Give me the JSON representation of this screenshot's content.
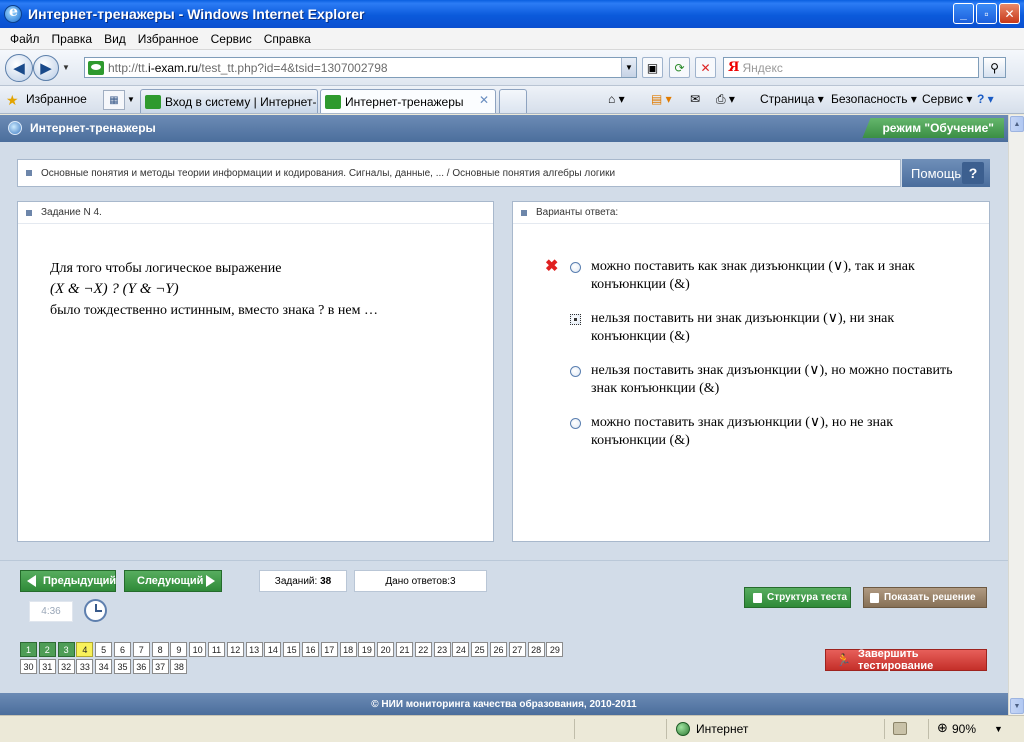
{
  "window": {
    "title": "Интернет-тренажеры - Windows Internet Explorer",
    "minimize": "_",
    "maximize": "▫",
    "close": "✕"
  },
  "menu": [
    "Файл",
    "Правка",
    "Вид",
    "Избранное",
    "Сервис",
    "Справка"
  ],
  "address": {
    "url_prefix": "http://tt.",
    "url_domain": "i-exam.ru",
    "url_rest": "/test_tt.php?id=4&tsid=1307002798"
  },
  "search": {
    "placeholder": "Яндекс",
    "logo": "Я"
  },
  "favorites": {
    "label": "Избранное",
    "tabs": [
      {
        "label": "Вход в систему | Интернет-...",
        "active": false
      },
      {
        "label": "Интернет-тренажеры",
        "active": true
      }
    ],
    "page_menu": "Страница ▾",
    "safety_menu": "Безопасность ▾",
    "service_menu": "Сервис ▾"
  },
  "site": {
    "title": "Интернет-тренажеры",
    "mode": "режим \"Обучение\"",
    "breadcrumb": "Основные понятия и методы теории информации и кодирования. Сигналы, данные, ... / Основные понятия алгебры логики",
    "help": "Помощь",
    "help_icon": "?"
  },
  "task": {
    "header": "Задание N 4.",
    "line1": "Для того чтобы логическое выражение",
    "formula": "(X & ¬X) ? (Y & ¬Y)",
    "line3": "было тождественно истинным, вместо знака  ?  в нем …"
  },
  "answers": {
    "header": "Варианты ответа:",
    "items": [
      {
        "text": "можно поставить как знак дизъюнкции (∨), так и знак конъюнкции (&)",
        "wrong": true,
        "selected": false
      },
      {
        "text": "нельзя поставить ни знак дизъюнкции (∨), ни знак конъюнкции (&)",
        "wrong": false,
        "selected": true
      },
      {
        "text": "нельзя поставить знак дизъюнкции (∨), но можно поставить знак конъюнкции (&)",
        "wrong": false,
        "selected": false
      },
      {
        "text": "можно поставить знак дизъюнкции (∨), но не знак конъюнкции (&)",
        "wrong": false,
        "selected": false
      }
    ]
  },
  "controls": {
    "prev": "Предыдущий",
    "next": "Следующий",
    "total_label": "Заданий:",
    "total_value": "38",
    "answered_label": "Дано ответов:",
    "answered_value": "3",
    "timer": "4:36",
    "structure": "Структура теста",
    "show_solution": "Показать решение",
    "finish": "Завершить тестирование"
  },
  "task_numbers": {
    "row1": [
      "1",
      "2",
      "3",
      "4",
      "5",
      "6",
      "7",
      "8",
      "9",
      "10",
      "11",
      "12",
      "13",
      "14",
      "15",
      "16",
      "17",
      "18",
      "19",
      "20",
      "21",
      "22",
      "23",
      "24",
      "25",
      "26",
      "27",
      "28",
      "29"
    ],
    "row2": [
      "30",
      "31",
      "32",
      "33",
      "34",
      "35",
      "36",
      "37",
      "38"
    ],
    "done": [
      "1",
      "2",
      "3"
    ],
    "current": "4"
  },
  "footer": "© НИИ мониторинга качества образования, 2010-2011",
  "status": {
    "zone": "Интернет",
    "zoom": "90%"
  },
  "colors": {
    "header": "#4b6e9c",
    "green": "#3b8e44",
    "red": "#c42f29"
  }
}
